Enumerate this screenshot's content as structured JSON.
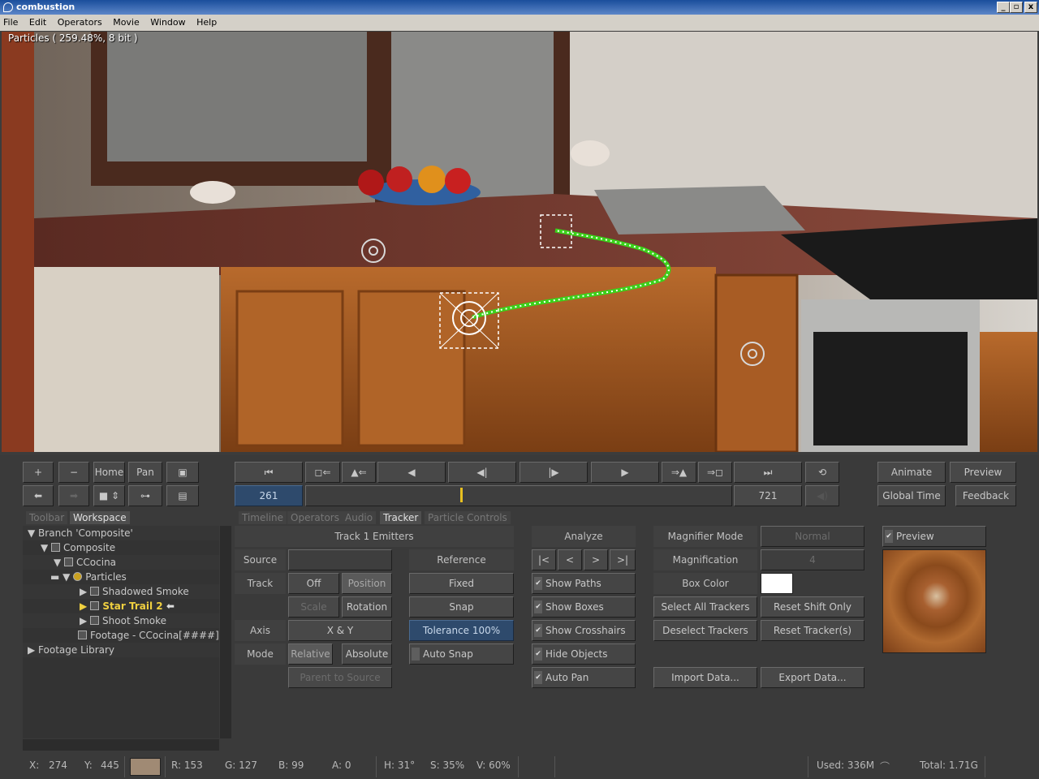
{
  "window": {
    "title": "combustion",
    "min": "_",
    "max": "▫",
    "close": "x"
  },
  "menu": [
    "File",
    "Edit",
    "Operators",
    "Movie",
    "Window",
    "Help"
  ],
  "viewport": {
    "label": "Particles ( 259.48%, 8 bit )"
  },
  "toolbar": {
    "plus": "+",
    "minus": "−",
    "home": "Home",
    "pan": "Pan"
  },
  "transport": {
    "current_frame": "261",
    "end_frame": "721",
    "playhead_fraction": 0.365
  },
  "right_buttons": {
    "animate": "Animate",
    "preview": "Preview",
    "global_time": "Global Time",
    "feedback": "Feedback"
  },
  "left_tabs": [
    "Toolbar",
    "Workspace"
  ],
  "main_tabs": [
    "Timeline",
    "Operators",
    "Audio",
    "Tracker",
    "Particle Controls"
  ],
  "active_tab": "Tracker",
  "tree": [
    {
      "label": "Branch 'Composite'"
    },
    {
      "label": "Composite"
    },
    {
      "label": "CCocina"
    },
    {
      "label": "Particles"
    },
    {
      "label": "Shadowed Smoke"
    },
    {
      "label": "Star Trail 2"
    },
    {
      "label": "Shoot Smoke"
    },
    {
      "label": "Footage - CCocina[####]"
    },
    {
      "label": "Footage Library"
    }
  ],
  "tracker": {
    "title": "Track 1 Emitters",
    "source_label": "Source",
    "track_label": "Track",
    "off": "Off",
    "position": "Position",
    "scale": "Scale",
    "rotation": "Rotation",
    "axis_label": "Axis",
    "axis_value": "X & Y",
    "mode_label": "Mode",
    "relative": "Relative",
    "absolute": "Absolute",
    "parent_to_source": "Parent to Source",
    "reference_label": "Reference",
    "fixed": "Fixed",
    "snap": "Snap",
    "tolerance": "Tolerance 100%",
    "auto_snap": "Auto Snap",
    "analyze_label": "Analyze",
    "show_paths": "Show Paths",
    "show_boxes": "Show Boxes",
    "show_crosshairs": "Show Crosshairs",
    "hide_objects": "Hide Objects",
    "auto_pan": "Auto Pan",
    "magnifier_mode_label": "Magnifier Mode",
    "magnifier_mode_value": "Normal",
    "magnification_label": "Magnification",
    "magnification_value": "4",
    "box_color_label": "Box Color",
    "box_color": "#ffffff",
    "select_all": "Select All Trackers",
    "deselect": "Deselect Trackers",
    "reset_shift": "Reset Shift Only",
    "reset_trackers": "Reset Tracker(s)",
    "import": "Import Data...",
    "export": "Export Data...",
    "preview_label": "Preview"
  },
  "status": {
    "x_label": "X:",
    "x": "274",
    "y_label": "Y:",
    "y": "445",
    "swatch": "#a08a74",
    "r": "R: 153",
    "g": "G: 127",
    "b": "B: 99",
    "a": "A: 0",
    "h": "H: 31°",
    "s": "S: 35%",
    "v": "V: 60%",
    "used": "Used: 336M",
    "total": "Total: 1.71G"
  }
}
